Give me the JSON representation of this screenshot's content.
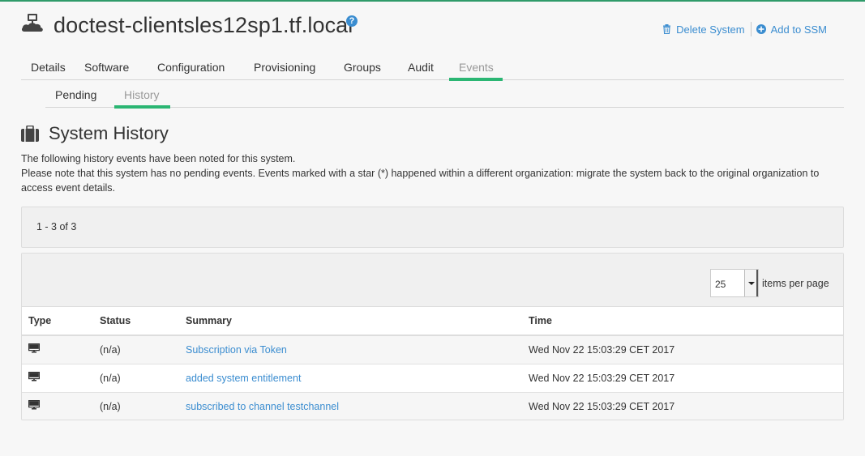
{
  "colors": {
    "accent": "#2bb673",
    "link": "#3b8dd0",
    "top_line": "#2f9b6a"
  },
  "header": {
    "title": "doctest-clientsles12sp1.tf.local",
    "help_icon": "question-circle-icon",
    "actions": {
      "delete_label": "Delete System",
      "delete_icon": "trash-icon",
      "ssm_label": "Add to SSM",
      "ssm_icon": "plus-circle-icon"
    }
  },
  "tabs": [
    "Details",
    "Software",
    "Configuration",
    "Provisioning",
    "Groups",
    "Audit",
    "Events"
  ],
  "active_tab": "Events",
  "subtabs": [
    "Pending",
    "History"
  ],
  "active_subtab": "History",
  "section": {
    "title": "System History",
    "icon": "suitcase-icon"
  },
  "description": {
    "line1": "The following history events have been noted for this system.",
    "line2": "Please note that this system has no pending events. Events marked with a star (*) happened within a different organization: migrate the system back to the original organization to access event details."
  },
  "pager": {
    "range_text": "1 - 3 of 3"
  },
  "per_page": {
    "value": "25",
    "label": "items per page"
  },
  "table": {
    "headers": {
      "type": "Type",
      "status": "Status",
      "summary": "Summary",
      "time": "Time"
    },
    "rows": [
      {
        "type_icon": "monitor-icon",
        "status": "(n/a)",
        "summary": "Subscription via Token",
        "time": "Wed Nov 22 15:03:29 CET 2017"
      },
      {
        "type_icon": "monitor-icon",
        "status": "(n/a)",
        "summary": "added system entitlement",
        "time": "Wed Nov 22 15:03:29 CET 2017"
      },
      {
        "type_icon": "monitor-icon",
        "status": "(n/a)",
        "summary": "subscribed to channel testchannel",
        "time": "Wed Nov 22 15:03:29 CET 2017"
      }
    ]
  }
}
